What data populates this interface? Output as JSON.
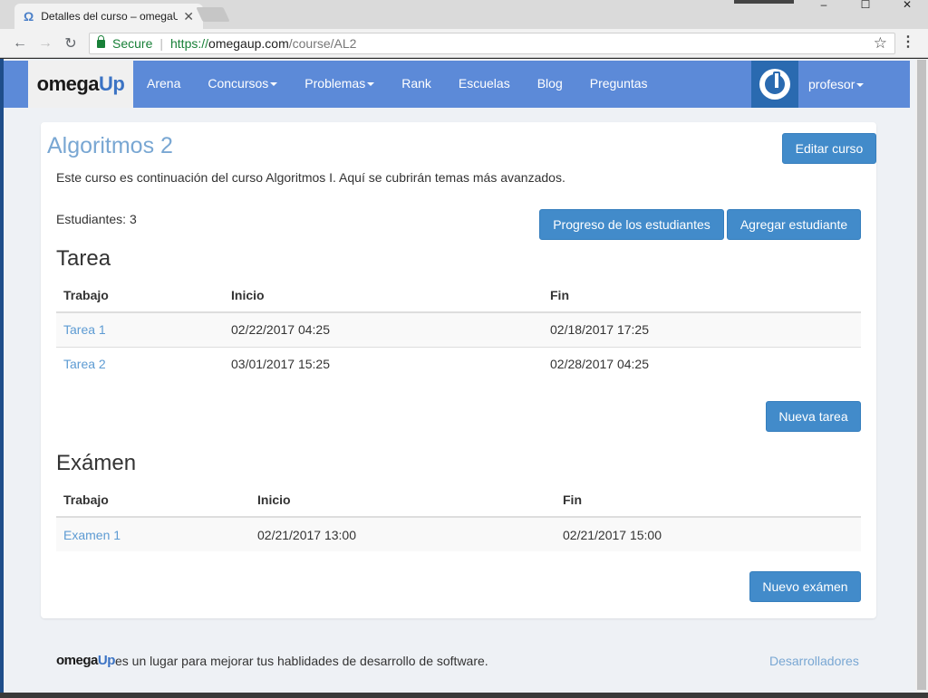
{
  "browser": {
    "tab_title": "Detalles del curso – omegaUp",
    "tab_close": "✕",
    "favicon": "Ω",
    "secure_label": "Secure",
    "url_scheme": "https://",
    "url_host": "omegaup.com",
    "url_path": "/course/AL2",
    "window_controls": [
      "–",
      "☐",
      "✕"
    ]
  },
  "navbar": {
    "brand_omega": "omega",
    "brand_up": "Up",
    "items": [
      {
        "label": "Arena",
        "dropdown": false
      },
      {
        "label": "Concursos",
        "dropdown": true
      },
      {
        "label": "Problemas",
        "dropdown": true
      },
      {
        "label": "Rank",
        "dropdown": false
      },
      {
        "label": "Escuelas",
        "dropdown": false
      },
      {
        "label": "Blog",
        "dropdown": false
      },
      {
        "label": "Preguntas",
        "dropdown": false
      }
    ],
    "user_name": "profesor"
  },
  "course": {
    "title": "Algoritmos 2",
    "edit_label": "Editar curso",
    "description": "Este curso es continuación del curso Algoritmos I. Aquí se cubrirán temas más avanzados.",
    "students_label": "Estudiantes: 3",
    "progress_label": "Progreso de los estudiantes",
    "add_student_label": "Agregar estudiante"
  },
  "homework": {
    "title": "Tarea",
    "columns": [
      "Trabajo",
      "Inicio",
      "Fin"
    ],
    "rows": [
      [
        "Tarea 1",
        "02/22/2017 04:25",
        "02/18/2017 17:25"
      ],
      [
        "Tarea 2",
        "03/01/2017 15:25",
        "02/28/2017 04:25"
      ]
    ],
    "new_label": "Nueva tarea"
  },
  "exams": {
    "title": "Exámen",
    "columns": [
      "Trabajo",
      "Inicio",
      "Fin"
    ],
    "rows": [
      [
        "Examen 1",
        "02/21/2017 13:00",
        "02/21/2017 15:00"
      ]
    ],
    "new_label": "Nuevo exámen"
  },
  "footer": {
    "logo_omega": "omega",
    "logo_up": "Up",
    "tagline": "es un lugar para mejorar tus hablidades de desarrollo de software.",
    "developers": "Desarrolladores"
  },
  "colors": {
    "navbar": "#5c8ad8",
    "button": "#428bca",
    "link": "#5d9bd3",
    "title": "#79a7d3"
  }
}
